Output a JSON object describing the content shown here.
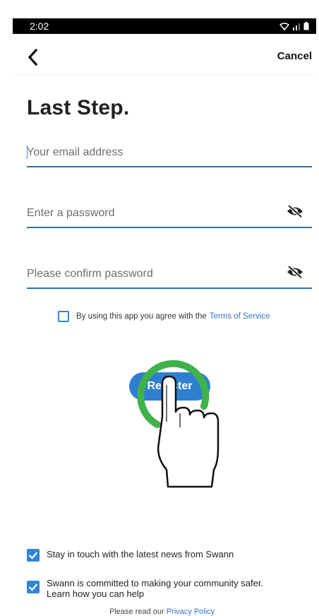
{
  "status_bar": {
    "time": "2:02"
  },
  "nav": {
    "cancel_label": "Cancel"
  },
  "page": {
    "title": "Last Step."
  },
  "form": {
    "email": {
      "value": "",
      "placeholder": "Your email address"
    },
    "password": {
      "value": "",
      "placeholder": "Enter a password"
    },
    "confirm_password": {
      "value": "",
      "placeholder": "Please confirm password"
    }
  },
  "terms": {
    "text": "By using this app you agree with the",
    "link": "Terms of Service",
    "checked": false
  },
  "register": {
    "label": "Register"
  },
  "options": [
    {
      "label": "Stay in touch with the latest news from Swann",
      "checked": true
    },
    {
      "label_line1": "Swann is committed to making your community safer.",
      "label_line2": "Learn how you can help",
      "checked": true
    }
  ],
  "privacy": {
    "prefix": "Please read our ",
    "link": "Privacy Policy"
  },
  "colors": {
    "accent": "#2e7fd0",
    "underline": "#2c6fb6",
    "tap_ring": "#3fb24a"
  },
  "icons": [
    "wifi-icon",
    "signal-icon",
    "battery-icon",
    "back-chevron-icon",
    "eye-off-icon",
    "checkmark-icon",
    "tap-gesture-icon"
  ]
}
